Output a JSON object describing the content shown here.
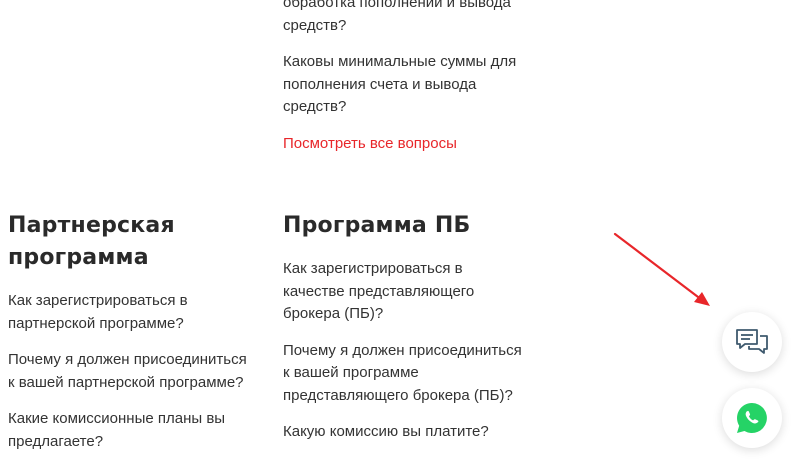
{
  "faq_top": {
    "items": [
      {
        "lines": [
          "обработка пополнений и вывода",
          "средств?"
        ]
      },
      {
        "lines": [
          "Каковы минимальные суммы для",
          "пополнения счета и вывода",
          "средств?"
        ]
      }
    ],
    "see_all": "Посмотреть все вопросы"
  },
  "partner_program": {
    "title_lines": [
      "Партнерская",
      "программа"
    ],
    "items": [
      {
        "lines": [
          "Как зарегистрироваться в",
          "партнерской программе?"
        ]
      },
      {
        "lines": [
          "Почему я должен присоединиться",
          "к вашей партнерской программе?"
        ]
      },
      {
        "lines": [
          "Какие комиссионные планы вы",
          "предлагаете?"
        ]
      }
    ]
  },
  "ib_program": {
    "title": "Программа ПБ",
    "items": [
      {
        "lines": [
          "Как зарегистрироваться в",
          "качестве представляющего",
          "брокера (ПБ)?"
        ]
      },
      {
        "lines": [
          "Почему я должен присоединиться",
          "к вашей программе",
          "представляющего брокера (ПБ)?"
        ]
      },
      {
        "lines": [
          "Какую комиссию вы платите?"
        ]
      }
    ]
  },
  "widgets": {
    "chat_icon": "chat-bubbles-icon",
    "whatsapp_icon": "whatsapp-icon",
    "whatsapp_color": "#25d366",
    "chat_color": "#3f5a6e"
  },
  "annotation": {
    "arrow_color": "#e8262a"
  }
}
